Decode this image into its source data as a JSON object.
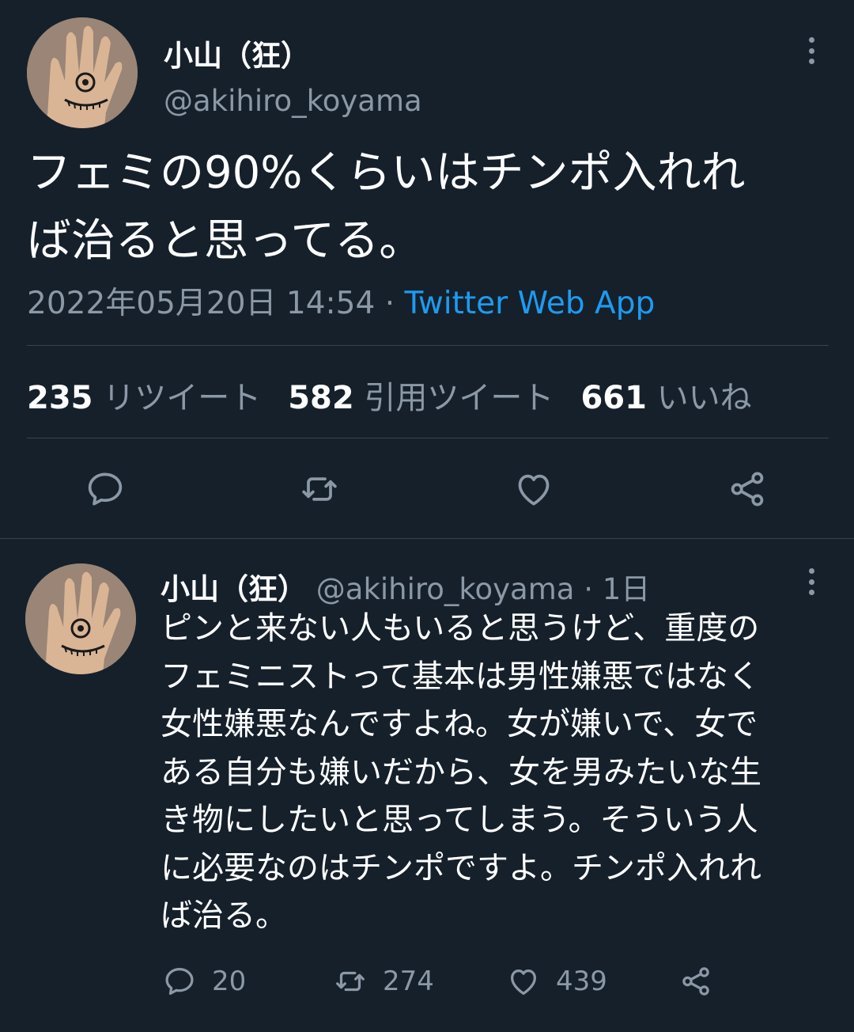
{
  "main_tweet": {
    "author_name": "小山（狂）",
    "author_handle": "@akihiro_koyama",
    "text": "フェミの90%くらいはチンポ入れれ\nば治ると思ってる。",
    "timestamp": "2022年05月20日 14:54",
    "separator": " · ",
    "source": "Twitter Web App",
    "stats": {
      "retweets_count": "235",
      "retweets_label": "リツイート",
      "quotes_count": "582",
      "quotes_label": "引用ツイート",
      "likes_count": "661",
      "likes_label": "いいね"
    },
    "actions": [
      "reply-icon",
      "retweet-icon",
      "like-icon",
      "share-icon"
    ]
  },
  "reply_tweet": {
    "author_name": "小山（狂）",
    "author_handle": "@akihiro_koyama",
    "time_ago": "· 1日",
    "text": "ピンと来ない人もいると思うけど、重度の\nフェミニストって基本は男性嫌悪ではなく\n女性嫌悪なんですよね。女が嫌いで、女で\nある自分も嫌いだから、女を男みたいな生\nき物にしたいと思ってしまう。そういう人\nに必要なのはチンポですよ。チンポ入れれ\nば治る。",
    "reply_count": "20",
    "retweet_count": "274",
    "like_count": "439"
  },
  "colors": {
    "background": "#15202b",
    "text_primary": "#ffffff",
    "text_secondary": "#8b98a5",
    "link": "#1d9bf0",
    "divider": "#38444d"
  }
}
